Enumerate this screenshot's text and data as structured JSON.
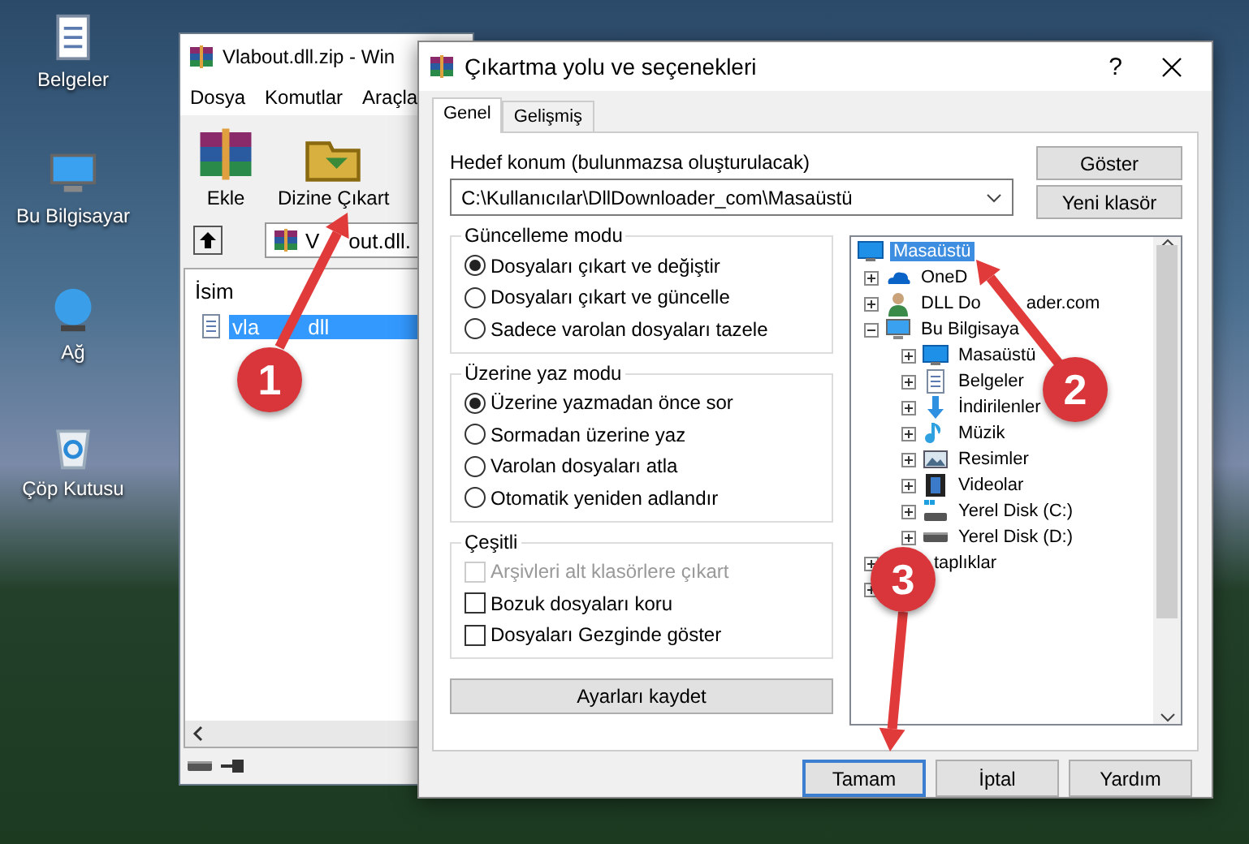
{
  "desktop": {
    "icons": [
      {
        "label": "Belgeler",
        "kind": "documents"
      },
      {
        "label": "Bu Bilgisayar",
        "kind": "computer"
      },
      {
        "label": "Ağ",
        "kind": "network"
      },
      {
        "label": "Çöp Kutusu",
        "kind": "recycle"
      }
    ]
  },
  "archiver": {
    "title": "Vlabout.dll.zip - Win",
    "menu": [
      "Dosya",
      "Komutlar",
      "Araçla"
    ],
    "toolbar": [
      {
        "label": "Ekle",
        "kind": "add"
      },
      {
        "label": "Dizine Çıkart",
        "kind": "extract"
      }
    ],
    "address": {
      "head": "V",
      "tail": "out.dll."
    },
    "column": "İsim",
    "files": [
      {
        "head": "vla",
        "tail": "dll",
        "selected": true
      }
    ]
  },
  "dialog": {
    "title": "Çıkartma yolu ve seçenekleri",
    "help": "?",
    "tabs": [
      {
        "label": "Genel",
        "selected": true
      },
      {
        "label": "Gelişmiş",
        "selected": false
      }
    ],
    "destination": {
      "label": "Hedef konum (bulunmazsa oluşturulacak)",
      "value": "C:\\Kullanıcılar\\DllDownloader_com\\Masaüstü"
    },
    "side_buttons": [
      "Göster",
      "Yeni klasör"
    ],
    "groups": [
      {
        "title": "Güncelleme modu",
        "kind": "radio",
        "options": [
          {
            "label": "Dosyaları çıkart ve değiştir",
            "selected": true
          },
          {
            "label": "Dosyaları çıkart ve güncelle",
            "selected": false
          },
          {
            "label": "Sadece varolan dosyaları tazele",
            "selected": false
          }
        ]
      },
      {
        "title": "Üzerine yaz modu",
        "kind": "radio",
        "options": [
          {
            "label": "Üzerine yazmadan önce sor",
            "selected": true
          },
          {
            "label": "Sormadan üzerine yaz",
            "selected": false
          },
          {
            "label": "Varolan dosyaları atla",
            "selected": false
          },
          {
            "label": "Otomatik yeniden adlandır",
            "selected": false
          }
        ]
      },
      {
        "title": "Çeşitli",
        "kind": "check",
        "options": [
          {
            "label": "Arşivleri alt klasörlere çıkart",
            "checked": false,
            "disabled": true
          },
          {
            "label": "Bozuk dosyaları koru",
            "checked": false,
            "disabled": false
          },
          {
            "label": "Dosyaları Gezginde göster",
            "checked": false,
            "disabled": false
          }
        ]
      }
    ],
    "save_button": "Ayarları kaydet",
    "tree": {
      "label": "Masaüstü",
      "kind": "desktop",
      "selected": true,
      "children": [
        {
          "label": "OneD",
          "kind": "cloud",
          "expanded": false,
          "selected": false
        },
        {
          "label": "DLL Do",
          "tail": "ader.com",
          "kind": "user",
          "expanded": false,
          "selected": false
        },
        {
          "label": "Bu Bilgisaya",
          "kind": "computer",
          "expanded": true,
          "selected": false,
          "children": [
            {
              "label": "Masaüstü",
              "kind": "desktop",
              "expanded": false,
              "selected": false
            },
            {
              "label": "Belgeler",
              "kind": "documents",
              "expanded": false,
              "selected": false
            },
            {
              "label": "İndirilenler",
              "kind": "download",
              "expanded": false,
              "selected": false
            },
            {
              "label": "Müzik",
              "kind": "music",
              "expanded": false,
              "selected": false
            },
            {
              "label": "Resimler",
              "kind": "pictures",
              "expanded": false,
              "selected": false
            },
            {
              "label": "Videolar",
              "kind": "video",
              "expanded": false,
              "selected": false
            },
            {
              "label": "Yerel Disk (C:)",
              "kind": "system-disk",
              "expanded": false,
              "selected": false
            },
            {
              "label": "Yerel Disk (D:)",
              "kind": "disk",
              "expanded": false,
              "selected": false
            }
          ]
        },
        {
          "label": "taplıklar",
          "kind": "hidden",
          "expanded": false,
          "selected": false
        },
        {
          "kind": "hidden",
          "expanded": false,
          "selected": false
        }
      ]
    },
    "buttons": [
      {
        "label": "Tamam",
        "kind": "default"
      },
      {
        "label": "İptal",
        "kind": "normal"
      },
      {
        "label": "Yardım",
        "kind": "normal"
      }
    ]
  },
  "callouts": [
    {
      "number": "1"
    },
    {
      "number": "2"
    },
    {
      "number": "3"
    }
  ]
}
